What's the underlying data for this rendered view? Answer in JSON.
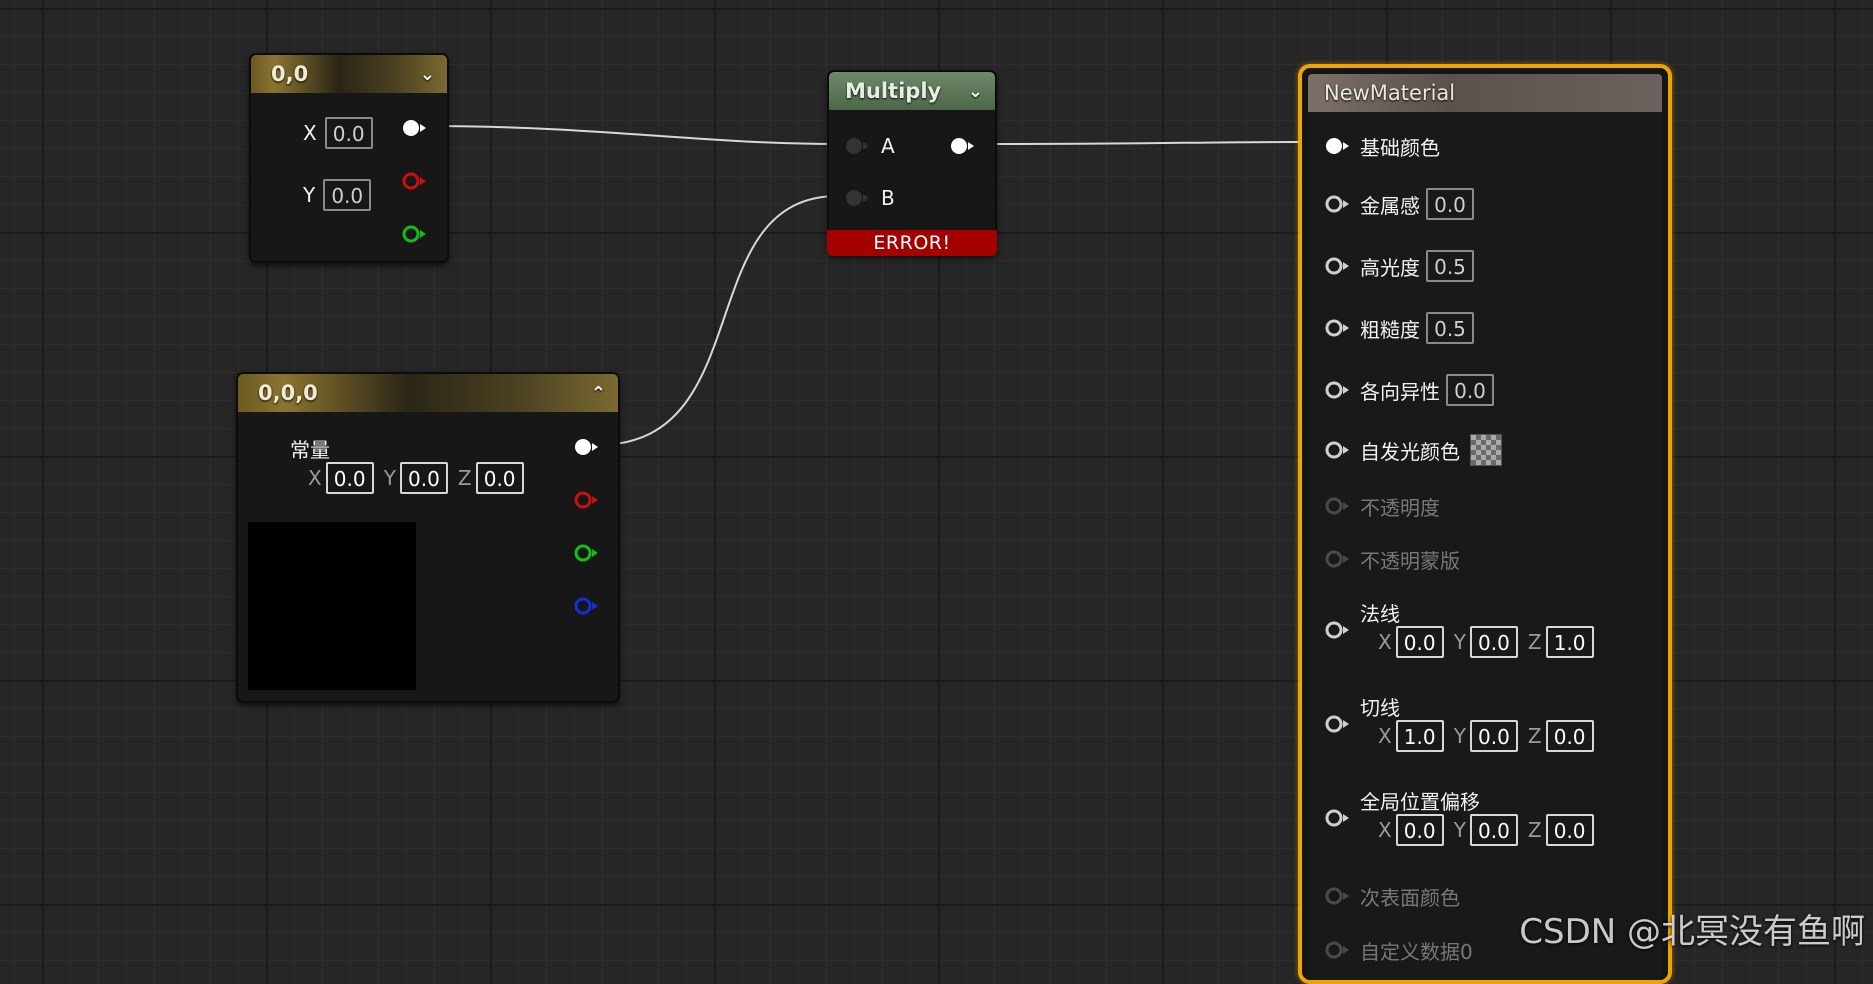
{
  "node_vec2": {
    "title": "0,0",
    "x_label": "X",
    "x_value": "0.0",
    "y_label": "Y",
    "y_value": "0.0"
  },
  "node_vec3": {
    "title": "0,0,0",
    "const_label": "常量",
    "x_label": "X",
    "x_value": "0.0",
    "y_label": "Y",
    "y_value": "0.0",
    "z_label": "Z",
    "z_value": "0.0",
    "preview_color": "#000000"
  },
  "node_multiply": {
    "title": "Multiply",
    "input_a": "A",
    "input_b": "B",
    "error_text": "ERROR!"
  },
  "material": {
    "title": "NewMaterial",
    "base_color": "基础颜色",
    "metallic": "金属感",
    "metallic_value": "0.0",
    "specular": "高光度",
    "specular_value": "0.5",
    "roughness": "粗糙度",
    "roughness_value": "0.5",
    "anisotropy": "各向异性",
    "anisotropy_value": "0.0",
    "emissive": "自发光颜色",
    "opacity": "不透明度",
    "opacity_mask": "不透明蒙版",
    "normal": "法线",
    "normal_x": "0.0",
    "normal_y": "0.0",
    "normal_z": "1.0",
    "tangent": "切线",
    "tangent_x": "1.0",
    "tangent_y": "0.0",
    "tangent_z": "0.0",
    "wpo": "全局位置偏移",
    "wpo_x": "0.0",
    "wpo_y": "0.0",
    "wpo_z": "0.0",
    "subsurface": "次表面颜色",
    "custom_data0": "自定义数据0",
    "axis_x": "X",
    "axis_y": "Y",
    "axis_z": "Z"
  },
  "colors": {
    "selection_outline": "#f0a400",
    "error": "#a40000",
    "pin_red": "#cc1010",
    "pin_green": "#10c010",
    "pin_blue": "#1030e0"
  },
  "watermark": "CSDN @北冥没有鱼啊"
}
